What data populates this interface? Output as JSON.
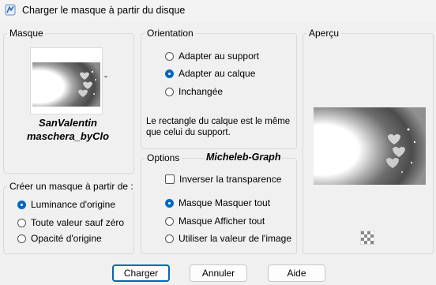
{
  "window": {
    "title": "Charger le masque à partir du disque"
  },
  "masque": {
    "label": "Masque",
    "name_line1": "SanValentin",
    "name_line2": "maschera_byClo"
  },
  "creer": {
    "label": "Créer un masque à partir de :",
    "options": [
      "Luminance d'origine",
      "Toute valeur sauf zéro",
      "Opacité d'origine"
    ],
    "selected": 0
  },
  "orientation": {
    "label": "Orientation",
    "options": [
      "Adapter au support",
      "Adapter au calque",
      "Inchangée"
    ],
    "selected": 1,
    "description": "Le rectangle du calque est le même que celui du support."
  },
  "options": {
    "label": "Options",
    "watermark": "Micheleb-Graph",
    "invert_label": "Inverser la transparence",
    "invert_checked": false,
    "radios": [
      "Masque Masquer tout",
      "Masque Afficher tout",
      "Utiliser la valeur de l'image"
    ],
    "selected": 0
  },
  "apercu": {
    "label": "Aperçu"
  },
  "buttons": {
    "load": "Charger",
    "cancel": "Annuler",
    "help": "Aide"
  },
  "icons": {
    "app": "paint-shop-pro-icon",
    "dropdown": "chevron-down-icon",
    "checker": "transparency-checker-icon"
  }
}
